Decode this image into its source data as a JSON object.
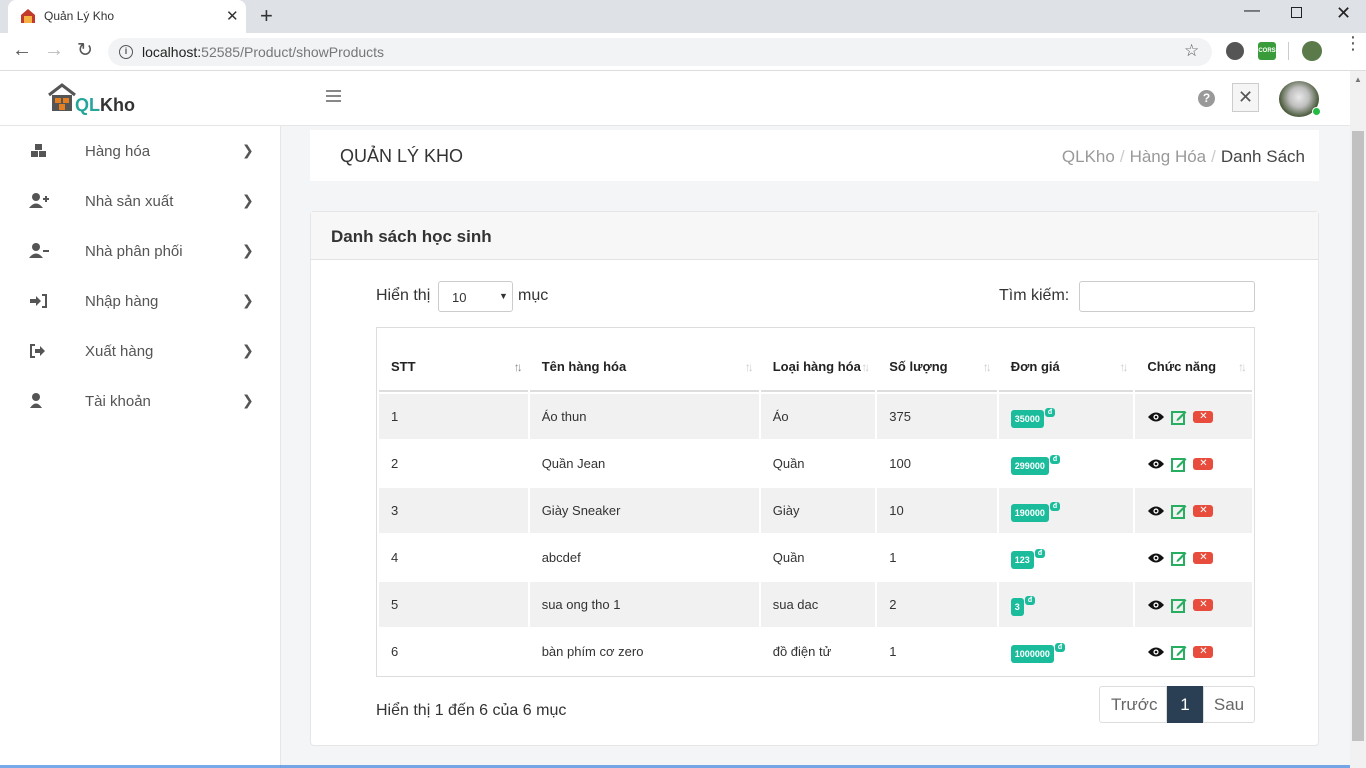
{
  "browser": {
    "tab_title": "Quản Lý Kho",
    "tab_close": "✕",
    "new_tab": "+",
    "url_host": "localhost:",
    "url_path": "52585/Product/showProducts",
    "ext_label": "CORS"
  },
  "header": {
    "logo_text_a": "QL",
    "logo_text_b": "Kho",
    "help": "?",
    "close": "✕"
  },
  "sidebar": {
    "items": [
      {
        "label": "Hàng hóa",
        "icon": "boxes-icon"
      },
      {
        "label": "Nhà sản xuất",
        "icon": "user-plus-icon"
      },
      {
        "label": "Nhà phân phối",
        "icon": "user-minus-icon"
      },
      {
        "label": "Nhập hàng",
        "icon": "sign-in-icon"
      },
      {
        "label": "Xuất hàng",
        "icon": "sign-out-icon"
      },
      {
        "label": "Tài khoản",
        "icon": "user-icon"
      }
    ]
  },
  "page": {
    "title": "QUẢN LÝ KHO",
    "breadcrumb": [
      "QLKho",
      "Hàng Hóa",
      "Danh Sách"
    ]
  },
  "card": {
    "title": "Danh sách học sinh",
    "length_label": "Hiển thị",
    "length_value": "10",
    "length_suffix": "mục",
    "search_label": "Tìm kiếm:",
    "search_value": ""
  },
  "table": {
    "headers": [
      "STT",
      "Tên hàng hóa",
      "Loại hàng hóa",
      "Số lượng",
      "Đơn giá",
      "Chức năng"
    ],
    "currency": "đ",
    "rows": [
      {
        "stt": "1",
        "name": "Áo thun",
        "type": "Áo",
        "qty": "375",
        "price": "35000"
      },
      {
        "stt": "2",
        "name": "Quần Jean",
        "type": "Quần",
        "qty": "100",
        "price": "299000"
      },
      {
        "stt": "3",
        "name": "Giày Sneaker",
        "type": "Giày",
        "qty": "10",
        "price": "190000"
      },
      {
        "stt": "4",
        "name": "abcdef",
        "type": "Quần",
        "qty": "1",
        "price": "123"
      },
      {
        "stt": "5",
        "name": "sua ong tho 1",
        "type": "sua dac",
        "qty": "2",
        "price": "3"
      },
      {
        "stt": "6",
        "name": "bàn phím cơ zero",
        "type": "đồ điện tử",
        "qty": "1",
        "price": "1000000"
      }
    ]
  },
  "footer": {
    "info": "Hiển thị 1 đến 6 của 6 mục",
    "prev": "Trước",
    "current": "1",
    "next": "Sau"
  },
  "colors": {
    "accent": "#1abc9c",
    "pagination_active": "#2a3f54",
    "delete": "#e74c3c",
    "edit": "#27ae60"
  }
}
